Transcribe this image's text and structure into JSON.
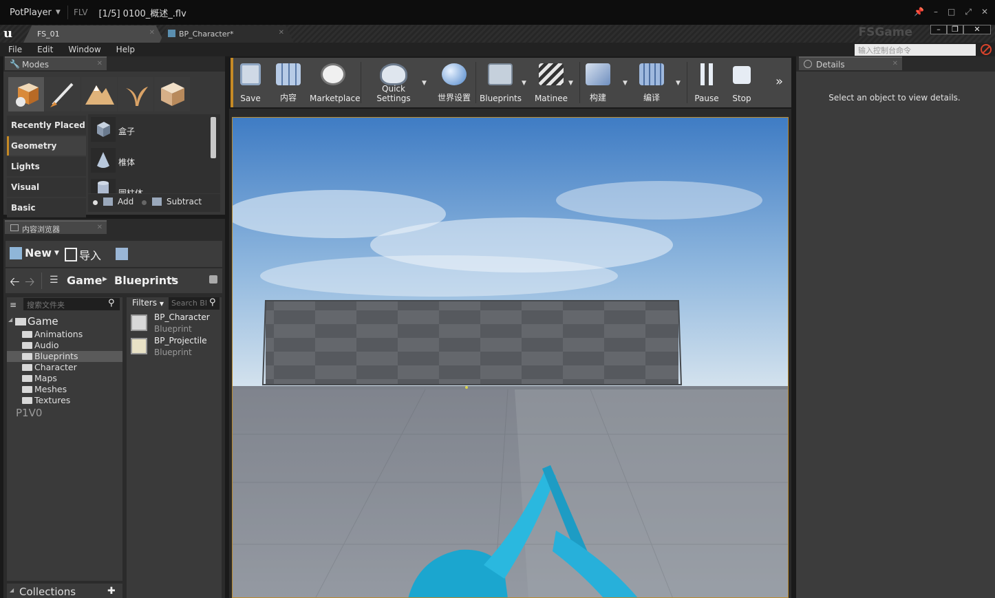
{
  "player": {
    "brand": "PotPlayer",
    "format": "FLV",
    "file_title": "[1/5] 0100_概述_.flv"
  },
  "editor": {
    "tabs": [
      {
        "label": "FS_01"
      },
      {
        "label": "BP_Character*"
      }
    ],
    "project_name": "FSGame",
    "menu": [
      "File",
      "Edit",
      "Window",
      "Help"
    ],
    "console_placeholder": "输入控制台命令"
  },
  "modes_panel": {
    "tab_label": "Modes",
    "categories": [
      "Recently Placed",
      "Geometry",
      "Lights",
      "Visual",
      "Basic"
    ],
    "selected_category": "Geometry",
    "items": [
      "盒子",
      "椎体",
      "圆柱体"
    ],
    "brush_add": "Add",
    "brush_subtract": "Subtract"
  },
  "content_browser": {
    "tab_label": "内容浏览器",
    "new_label": "New",
    "import_label": "导入",
    "path": [
      "Game",
      "Blueprints"
    ],
    "folder_search_placeholder": "搜索文件夹",
    "filters_label": "Filters",
    "asset_search_placeholder": "Search Bl",
    "tree_root": "Game",
    "folders": [
      "Animations",
      "Audio",
      "Blueprints",
      "Character",
      "Maps",
      "Meshes",
      "Textures"
    ],
    "selected_folder": "Blueprints",
    "extra_node": "P1V0",
    "assets": [
      {
        "name": "BP_Character",
        "type": "Blueprint"
      },
      {
        "name": "BP_Projectile",
        "type": "Blueprint"
      }
    ],
    "collections_label": "Collections"
  },
  "toolbar": {
    "save": "Save",
    "content": "内容",
    "marketplace": "Marketplace",
    "quick_settings": "Quick Settings",
    "world_settings": "世界设置",
    "blueprints": "Blueprints",
    "matinee": "Matinee",
    "build": "构建",
    "compile": "编译",
    "pause": "Pause",
    "stop": "Stop"
  },
  "details_panel": {
    "tab_label": "Details",
    "empty_message": "Select an object to view details."
  }
}
